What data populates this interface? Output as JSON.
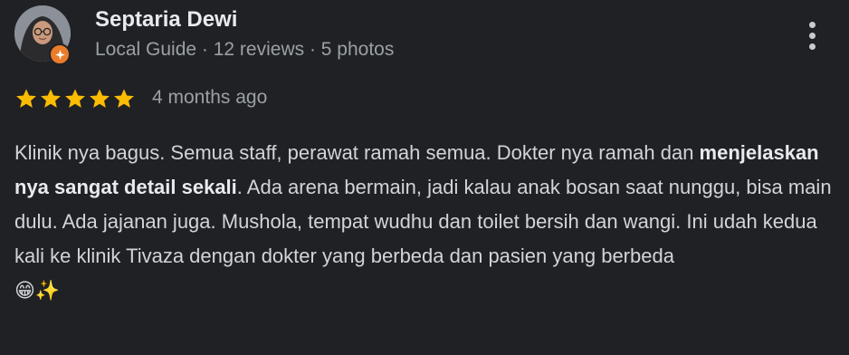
{
  "reviewer": {
    "name": "Septaria Dewi",
    "meta": "Local Guide · 12 reviews · 5 photos",
    "avatar_icon": "user-avatar",
    "badge_icon": "local-guide-star-badge",
    "badge_color": "#ea7d2b"
  },
  "rating": {
    "stars": 5,
    "max_stars": 5,
    "star_color": "#fbbc04",
    "time_ago": "4 months ago"
  },
  "menu": {
    "icon": "more-vertical-icon"
  },
  "review": {
    "part1": "Klinik nya bagus. Semua staff, perawat ramah semua. Dokter nya ramah dan ",
    "bold": "menjelaskan nya sangat detail sekali",
    "part2": ". Ada arena bermain, jadi kalau anak bosan saat nunggu, bisa main dulu. Ada jajanan juga. Mushola, tempat wudhu dan toilet bersih dan wangi. Ini udah kedua kali ke klinik Tivaza dengan dokter yang berbeda dan pasien yang berbeda",
    "emoji": "😁✨"
  }
}
